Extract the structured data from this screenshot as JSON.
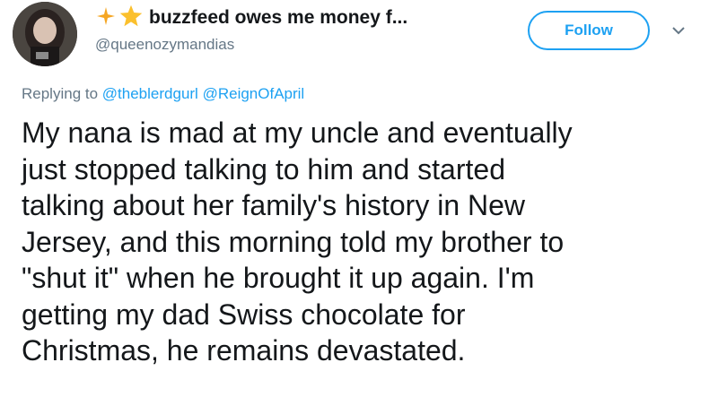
{
  "user": {
    "display_name": "buzzfeed owes me money f...",
    "handle": "@queenozymandias",
    "emoji_icons": [
      "sparkle-icon",
      "star-icon"
    ]
  },
  "follow": {
    "label": "Follow"
  },
  "reply": {
    "prefix": "Replying to",
    "mentions": [
      "@theblerdgurl",
      "@ReignOfApril"
    ]
  },
  "tweet": {
    "lines": [
      "My nana is mad at my uncle and eventually",
      "just stopped talking to him and started",
      "talking about her family's history in New",
      "Jersey, and this morning told my brother to",
      "\"shut it\" when he brought it up again. I'm",
      "getting my dad Swiss chocolate for",
      "Christmas, he remains devastated."
    ]
  },
  "colors": {
    "accent": "#1da1f2",
    "secondary_text": "#657786",
    "primary_text": "#14171a"
  }
}
